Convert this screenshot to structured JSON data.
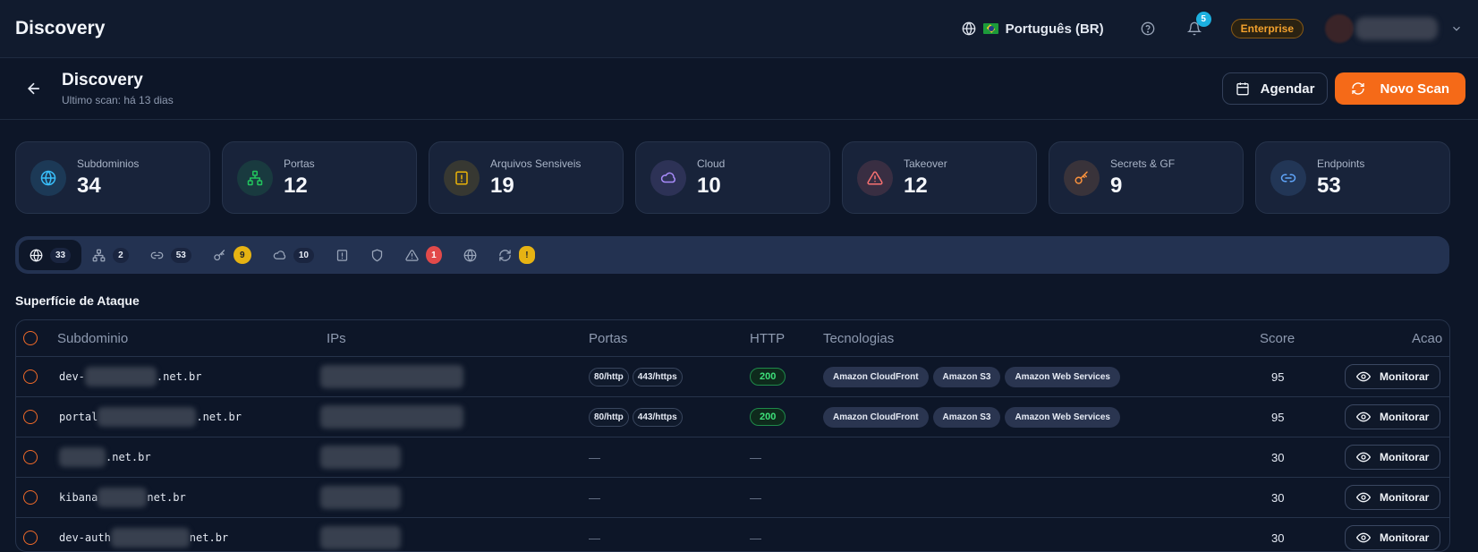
{
  "app": {
    "title": "Discovery"
  },
  "topbar": {
    "language": "Português (BR)",
    "notifications_count": "5",
    "plan_badge": "Enterprise"
  },
  "page": {
    "title": "Discovery",
    "subtitle": "Ultimo scan: há 13 dias",
    "schedule_label": "Agendar",
    "new_scan_label": "Novo Scan"
  },
  "stats": [
    {
      "label": "Subdominios",
      "value": "34",
      "icon": "globe-icon",
      "color": "#38bdf8"
    },
    {
      "label": "Portas",
      "value": "12",
      "icon": "network-icon",
      "color": "#22c55e"
    },
    {
      "label": "Arquivos Sensiveis",
      "value": "19",
      "icon": "file-alert-icon",
      "color": "#eab308"
    },
    {
      "label": "Cloud",
      "value": "10",
      "icon": "cloud-icon",
      "color": "#a78bfa"
    },
    {
      "label": "Takeover",
      "value": "12",
      "icon": "warning-icon",
      "color": "#f87171"
    },
    {
      "label": "Secrets & GF",
      "value": "9",
      "icon": "key-icon",
      "color": "#fb923c"
    },
    {
      "label": "Endpoints",
      "value": "53",
      "icon": "link-icon",
      "color": "#60a5fa"
    }
  ],
  "filters": [
    {
      "icon": "globe-icon",
      "count": "33",
      "style": "pill",
      "active": true
    },
    {
      "icon": "network-icon",
      "count": "2",
      "style": "pill"
    },
    {
      "icon": "link-icon",
      "count": "53",
      "style": "pill"
    },
    {
      "icon": "key-icon",
      "count": "9",
      "style": "yellow"
    },
    {
      "icon": "cloud-icon",
      "count": "10",
      "style": "pill"
    },
    {
      "icon": "file-alert-icon",
      "count": "",
      "style": "none"
    },
    {
      "icon": "shield-icon",
      "count": "",
      "style": "none"
    },
    {
      "icon": "warning-icon",
      "count": "1",
      "style": "red"
    },
    {
      "icon": "globe-icon",
      "count": "",
      "style": "none"
    },
    {
      "icon": "refresh-icon",
      "count": "!",
      "style": "dot"
    }
  ],
  "section_title": "Superfície de Ataque",
  "table": {
    "headers": {
      "subdomain": "Subdominio",
      "ips": "IPs",
      "ports": "Portas",
      "http": "HTTP",
      "tech": "Tecnologias",
      "score": "Score",
      "action": "Acao"
    },
    "monitor_label": "Monitorar",
    "dash": "—",
    "rows": [
      {
        "prefix": "dev-",
        "suffix": ".net.br",
        "ports": [
          "80/http",
          "443/https"
        ],
        "http": "200",
        "tech": [
          "Amazon CloudFront",
          "Amazon S3",
          "Amazon Web Services"
        ],
        "score": "95"
      },
      {
        "prefix": "portal",
        "suffix": ".net.br",
        "ports": [
          "80/http",
          "443/https"
        ],
        "http": "200",
        "tech": [
          "Amazon CloudFront",
          "Amazon S3",
          "Amazon Web Services"
        ],
        "score": "95"
      },
      {
        "prefix": "",
        "suffix": ".net.br",
        "ports": [],
        "http": "",
        "tech": [],
        "score": "30"
      },
      {
        "prefix": "kibana",
        "suffix": "net.br",
        "ports": [],
        "http": "",
        "tech": [],
        "score": "30"
      },
      {
        "prefix": "dev-auth",
        "suffix": "net.br",
        "ports": [],
        "http": "",
        "tech": [],
        "score": "30"
      }
    ]
  }
}
